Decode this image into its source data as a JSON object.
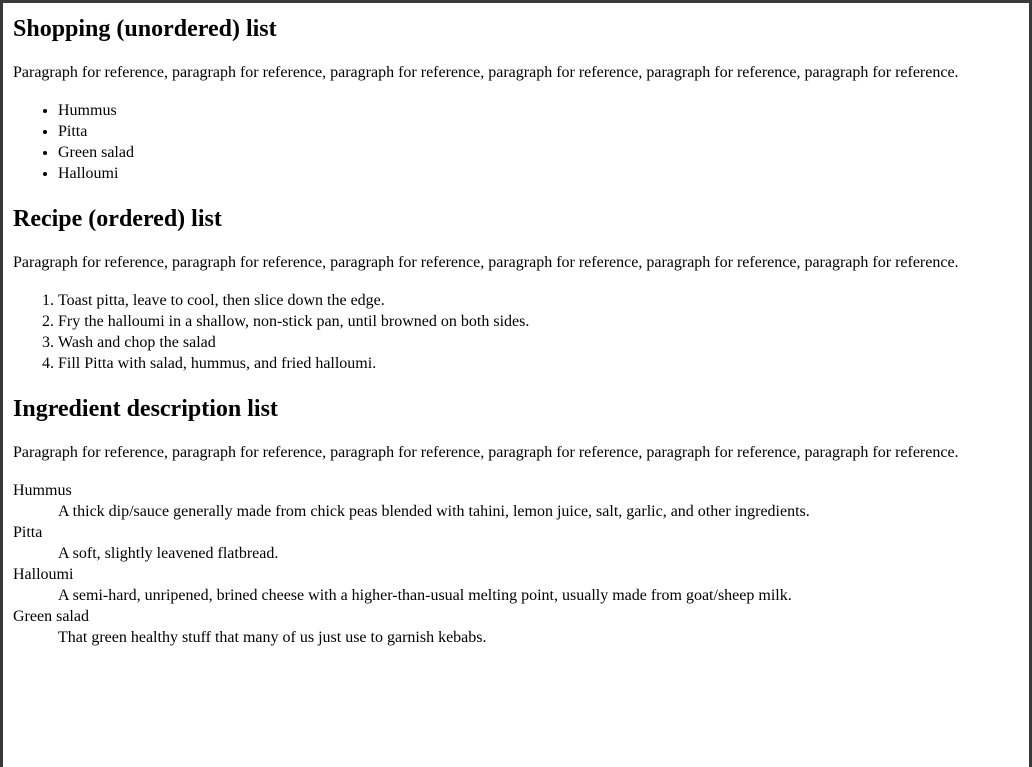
{
  "sections": [
    {
      "heading": "Shopping (unordered) list",
      "paragraph": "Paragraph for reference, paragraph for reference, paragraph for reference, paragraph for reference, paragraph for reference, paragraph for reference.",
      "items": [
        "Hummus",
        "Pitta",
        "Green salad",
        "Halloumi"
      ]
    },
    {
      "heading": "Recipe (ordered) list",
      "paragraph": "Paragraph for reference, paragraph for reference, paragraph for reference, paragraph for reference, paragraph for reference, paragraph for reference.",
      "items": [
        "Toast pitta, leave to cool, then slice down the edge.",
        "Fry the halloumi in a shallow, non-stick pan, until browned on both sides.",
        "Wash and chop the salad",
        "Fill Pitta with salad, hummus, and fried halloumi."
      ]
    },
    {
      "heading": "Ingredient description list",
      "paragraph": "Paragraph for reference, paragraph for reference, paragraph for reference, paragraph for reference, paragraph for reference, paragraph for reference.",
      "terms": [
        {
          "term": "Hummus",
          "desc": "A thick dip/sauce generally made from chick peas blended with tahini, lemon juice, salt, garlic, and other ingredients."
        },
        {
          "term": "Pitta",
          "desc": "A soft, slightly leavened flatbread."
        },
        {
          "term": "Halloumi",
          "desc": "A semi-hard, unripened, brined cheese with a higher-than-usual melting point, usually made from goat/sheep milk."
        },
        {
          "term": "Green salad",
          "desc": "That green healthy stuff that many of us just use to garnish kebabs."
        }
      ]
    }
  ]
}
